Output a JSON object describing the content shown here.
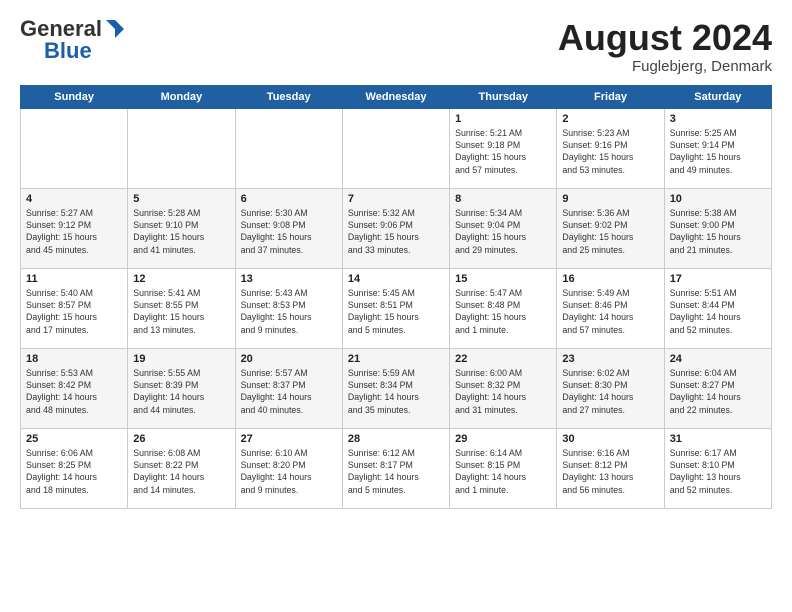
{
  "header": {
    "logo_general": "General",
    "logo_blue": "Blue",
    "title": "August 2024",
    "location": "Fuglebjerg, Denmark"
  },
  "weekdays": [
    "Sunday",
    "Monday",
    "Tuesday",
    "Wednesday",
    "Thursday",
    "Friday",
    "Saturday"
  ],
  "rows": [
    {
      "alt": false,
      "days": [
        {
          "num": "",
          "detail": ""
        },
        {
          "num": "",
          "detail": ""
        },
        {
          "num": "",
          "detail": ""
        },
        {
          "num": "",
          "detail": ""
        },
        {
          "num": "1",
          "detail": "Sunrise: 5:21 AM\nSunset: 9:18 PM\nDaylight: 15 hours\nand 57 minutes."
        },
        {
          "num": "2",
          "detail": "Sunrise: 5:23 AM\nSunset: 9:16 PM\nDaylight: 15 hours\nand 53 minutes."
        },
        {
          "num": "3",
          "detail": "Sunrise: 5:25 AM\nSunset: 9:14 PM\nDaylight: 15 hours\nand 49 minutes."
        }
      ]
    },
    {
      "alt": true,
      "days": [
        {
          "num": "4",
          "detail": "Sunrise: 5:27 AM\nSunset: 9:12 PM\nDaylight: 15 hours\nand 45 minutes."
        },
        {
          "num": "5",
          "detail": "Sunrise: 5:28 AM\nSunset: 9:10 PM\nDaylight: 15 hours\nand 41 minutes."
        },
        {
          "num": "6",
          "detail": "Sunrise: 5:30 AM\nSunset: 9:08 PM\nDaylight: 15 hours\nand 37 minutes."
        },
        {
          "num": "7",
          "detail": "Sunrise: 5:32 AM\nSunset: 9:06 PM\nDaylight: 15 hours\nand 33 minutes."
        },
        {
          "num": "8",
          "detail": "Sunrise: 5:34 AM\nSunset: 9:04 PM\nDaylight: 15 hours\nand 29 minutes."
        },
        {
          "num": "9",
          "detail": "Sunrise: 5:36 AM\nSunset: 9:02 PM\nDaylight: 15 hours\nand 25 minutes."
        },
        {
          "num": "10",
          "detail": "Sunrise: 5:38 AM\nSunset: 9:00 PM\nDaylight: 15 hours\nand 21 minutes."
        }
      ]
    },
    {
      "alt": false,
      "days": [
        {
          "num": "11",
          "detail": "Sunrise: 5:40 AM\nSunset: 8:57 PM\nDaylight: 15 hours\nand 17 minutes."
        },
        {
          "num": "12",
          "detail": "Sunrise: 5:41 AM\nSunset: 8:55 PM\nDaylight: 15 hours\nand 13 minutes."
        },
        {
          "num": "13",
          "detail": "Sunrise: 5:43 AM\nSunset: 8:53 PM\nDaylight: 15 hours\nand 9 minutes."
        },
        {
          "num": "14",
          "detail": "Sunrise: 5:45 AM\nSunset: 8:51 PM\nDaylight: 15 hours\nand 5 minutes."
        },
        {
          "num": "15",
          "detail": "Sunrise: 5:47 AM\nSunset: 8:48 PM\nDaylight: 15 hours\nand 1 minute."
        },
        {
          "num": "16",
          "detail": "Sunrise: 5:49 AM\nSunset: 8:46 PM\nDaylight: 14 hours\nand 57 minutes."
        },
        {
          "num": "17",
          "detail": "Sunrise: 5:51 AM\nSunset: 8:44 PM\nDaylight: 14 hours\nand 52 minutes."
        }
      ]
    },
    {
      "alt": true,
      "days": [
        {
          "num": "18",
          "detail": "Sunrise: 5:53 AM\nSunset: 8:42 PM\nDaylight: 14 hours\nand 48 minutes."
        },
        {
          "num": "19",
          "detail": "Sunrise: 5:55 AM\nSunset: 8:39 PM\nDaylight: 14 hours\nand 44 minutes."
        },
        {
          "num": "20",
          "detail": "Sunrise: 5:57 AM\nSunset: 8:37 PM\nDaylight: 14 hours\nand 40 minutes."
        },
        {
          "num": "21",
          "detail": "Sunrise: 5:59 AM\nSunset: 8:34 PM\nDaylight: 14 hours\nand 35 minutes."
        },
        {
          "num": "22",
          "detail": "Sunrise: 6:00 AM\nSunset: 8:32 PM\nDaylight: 14 hours\nand 31 minutes."
        },
        {
          "num": "23",
          "detail": "Sunrise: 6:02 AM\nSunset: 8:30 PM\nDaylight: 14 hours\nand 27 minutes."
        },
        {
          "num": "24",
          "detail": "Sunrise: 6:04 AM\nSunset: 8:27 PM\nDaylight: 14 hours\nand 22 minutes."
        }
      ]
    },
    {
      "alt": false,
      "days": [
        {
          "num": "25",
          "detail": "Sunrise: 6:06 AM\nSunset: 8:25 PM\nDaylight: 14 hours\nand 18 minutes."
        },
        {
          "num": "26",
          "detail": "Sunrise: 6:08 AM\nSunset: 8:22 PM\nDaylight: 14 hours\nand 14 minutes."
        },
        {
          "num": "27",
          "detail": "Sunrise: 6:10 AM\nSunset: 8:20 PM\nDaylight: 14 hours\nand 9 minutes."
        },
        {
          "num": "28",
          "detail": "Sunrise: 6:12 AM\nSunset: 8:17 PM\nDaylight: 14 hours\nand 5 minutes."
        },
        {
          "num": "29",
          "detail": "Sunrise: 6:14 AM\nSunset: 8:15 PM\nDaylight: 14 hours\nand 1 minute."
        },
        {
          "num": "30",
          "detail": "Sunrise: 6:16 AM\nSunset: 8:12 PM\nDaylight: 13 hours\nand 56 minutes."
        },
        {
          "num": "31",
          "detail": "Sunrise: 6:17 AM\nSunset: 8:10 PM\nDaylight: 13 hours\nand 52 minutes."
        }
      ]
    }
  ]
}
